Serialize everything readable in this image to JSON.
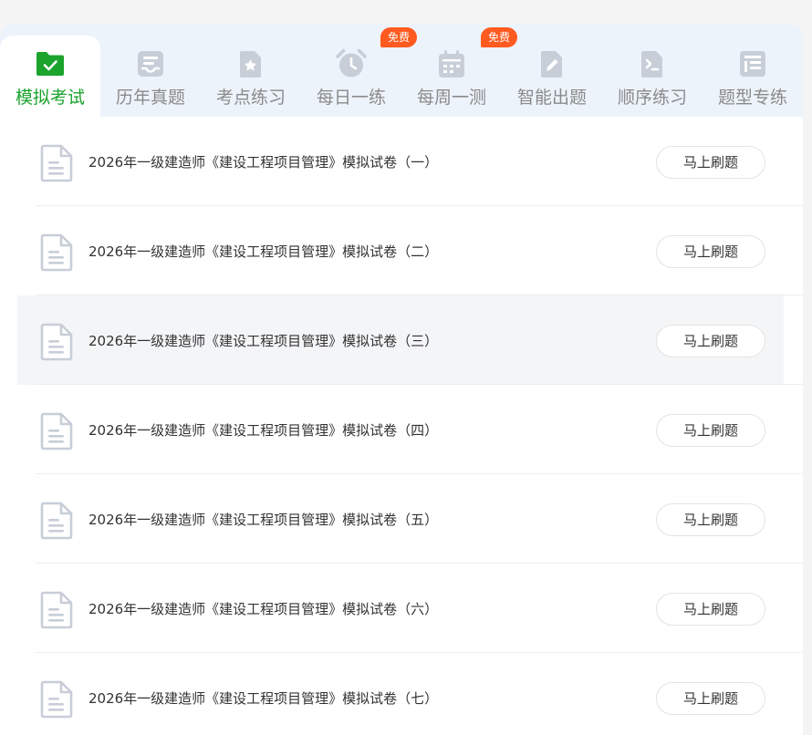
{
  "tabs": [
    {
      "label": "模拟考试",
      "icon": "folder-check-icon",
      "active": true
    },
    {
      "label": "历年真题",
      "icon": "tray-list-icon",
      "active": false
    },
    {
      "label": "考点练习",
      "icon": "star-document-icon",
      "active": false
    },
    {
      "label": "每日一练",
      "icon": "alarm-clock-icon",
      "active": false,
      "badge": "免费"
    },
    {
      "label": "每周一测",
      "icon": "calendar-icon",
      "active": false,
      "badge": "免费"
    },
    {
      "label": "智能出题",
      "icon": "pencil-document-icon",
      "active": false
    },
    {
      "label": "顺序练习",
      "icon": "code-document-icon",
      "active": false
    },
    {
      "label": "题型专练",
      "icon": "grid-list-icon",
      "active": false
    }
  ],
  "papers": [
    {
      "title": "2026年一级建造师《建设工程项目管理》模拟试卷（一）",
      "button": "马上刷题"
    },
    {
      "title": "2026年一级建造师《建设工程项目管理》模拟试卷（二）",
      "button": "马上刷题"
    },
    {
      "title": "2026年一级建造师《建设工程项目管理》模拟试卷（三）",
      "button": "马上刷题"
    },
    {
      "title": "2026年一级建造师《建设工程项目管理》模拟试卷（四）",
      "button": "马上刷题"
    },
    {
      "title": "2026年一级建造师《建设工程项目管理》模拟试卷（五）",
      "button": "马上刷题"
    },
    {
      "title": "2026年一级建造师《建设工程项目管理》模拟试卷（六）",
      "button": "马上刷题"
    },
    {
      "title": "2026年一级建造师《建设工程项目管理》模拟试卷（七）",
      "button": "马上刷题"
    }
  ],
  "colors": {
    "accent_green": "#1aa32d",
    "tab_bar_bg": "#edf3fb",
    "icon_grey": "#c7ced8",
    "badge_orange": "#ff5a1f",
    "row_highlight": "#f4f5f7"
  },
  "hovered_row": 2
}
